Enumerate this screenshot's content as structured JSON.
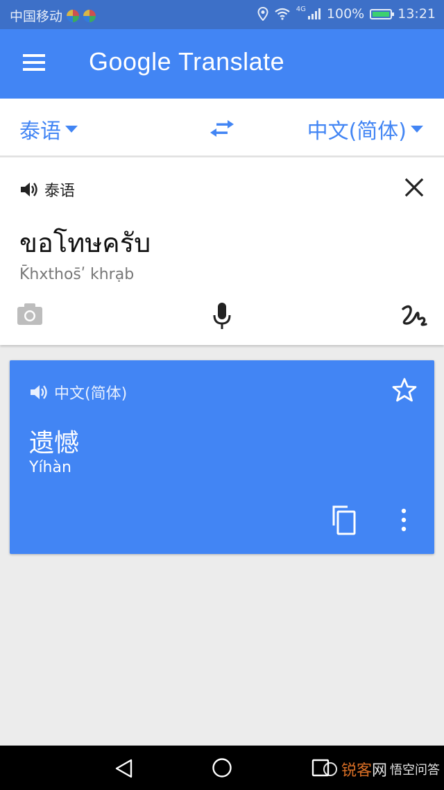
{
  "status_bar": {
    "carrier": "中国移动",
    "battery": "100%",
    "time": "13:21",
    "signal_label": "4G"
  },
  "app": {
    "title_google": "Google",
    "title_translate": "Translate"
  },
  "language_bar": {
    "source_language": "泰语",
    "target_language": "中文(简体)"
  },
  "input": {
    "language_label": "泰语",
    "source_text": "ขอโทษครับ",
    "transliteration": "K̄hxthos̄ʹ khrạb"
  },
  "result": {
    "language_label": "中文(简体)",
    "translation": "遗憾",
    "transliteration": "Yíhàn"
  },
  "watermark": {
    "brand_a": "锐客",
    "brand_b": "网",
    "brand_c": "悟空问答"
  },
  "colors": {
    "status_bar": "#3d70c8",
    "app_bar": "#4285f4",
    "accent": "#4285f4",
    "background": "#ececec"
  },
  "icons": {
    "menu": "hamburger-icon",
    "swap": "swap-arrows-icon",
    "speaker": "volume-icon",
    "close": "close-icon",
    "camera": "camera-icon",
    "mic": "microphone-icon",
    "handwriting": "handwriting-icon",
    "star": "star-icon",
    "copy": "copy-icon",
    "more": "more-vert-icon"
  }
}
